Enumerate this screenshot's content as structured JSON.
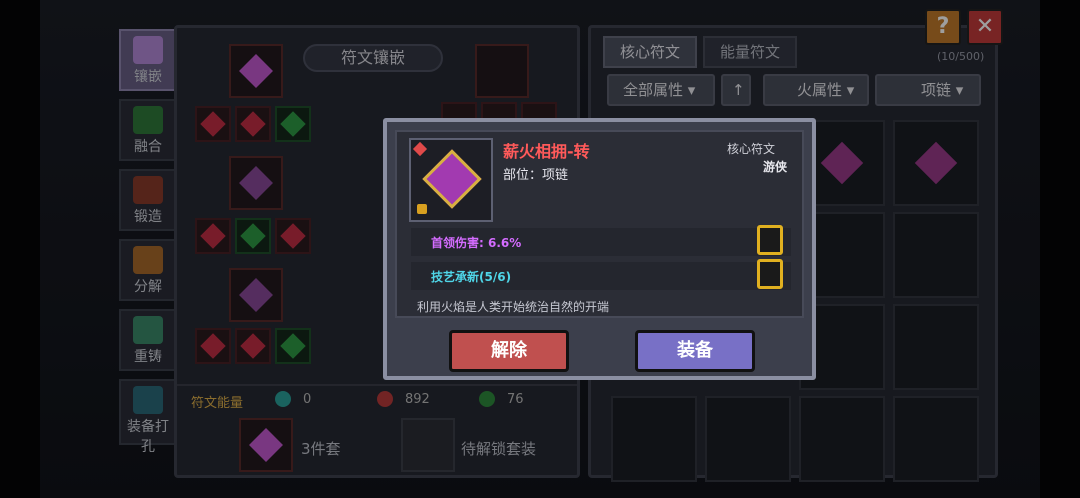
{
  "left_tabs": [
    {
      "label": "镶嵌",
      "icon": "rune-slot-icon",
      "active": true
    },
    {
      "label": "融合",
      "icon": "fusion-icon",
      "active": false
    },
    {
      "label": "锻造",
      "icon": "forge-icon",
      "active": false
    },
    {
      "label": "分解",
      "icon": "decompose-icon",
      "active": false
    },
    {
      "label": "重铸",
      "icon": "recast-icon",
      "active": false
    },
    {
      "label": "装备打孔",
      "icon": "drill-icon",
      "active": false
    }
  ],
  "inlay_panel": {
    "title": "符文镶嵌",
    "energy_label": "符文能量",
    "energy": [
      {
        "icon": "blue-energy-icon",
        "value": "0"
      },
      {
        "icon": "fire-energy-icon",
        "value": "892"
      },
      {
        "icon": "green-energy-icon",
        "value": "76"
      }
    ],
    "set_label": "3件套",
    "locked_set_label": "待解锁套装"
  },
  "top_buttons": {
    "help": "?",
    "close": "✕"
  },
  "rune_panel": {
    "tabs": [
      "核心符文",
      "能量符文"
    ],
    "count": "(10/500)",
    "filters": {
      "all": "全部属性",
      "sort": "↑",
      "element": "火属性",
      "slot": "项链"
    }
  },
  "modal": {
    "name": "薪火相拥-转",
    "slot_text": "部位：项链",
    "type": "核心符文",
    "class": "游侠",
    "stat1": "首领伤害: 6.6%",
    "stat2": "技艺承新(5/6)",
    "description": "利用火焰是人类开始统治自然的开端",
    "btn_remove": "解除",
    "btn_equip": "装备"
  },
  "colors": {
    "rune_name": "#ff5a5a",
    "stat1": "#d46cff",
    "stat2": "#4fd6e8",
    "remove_btn": "#c0504f",
    "equip_btn": "#7870c6",
    "lock_gold": "#e0b020"
  }
}
